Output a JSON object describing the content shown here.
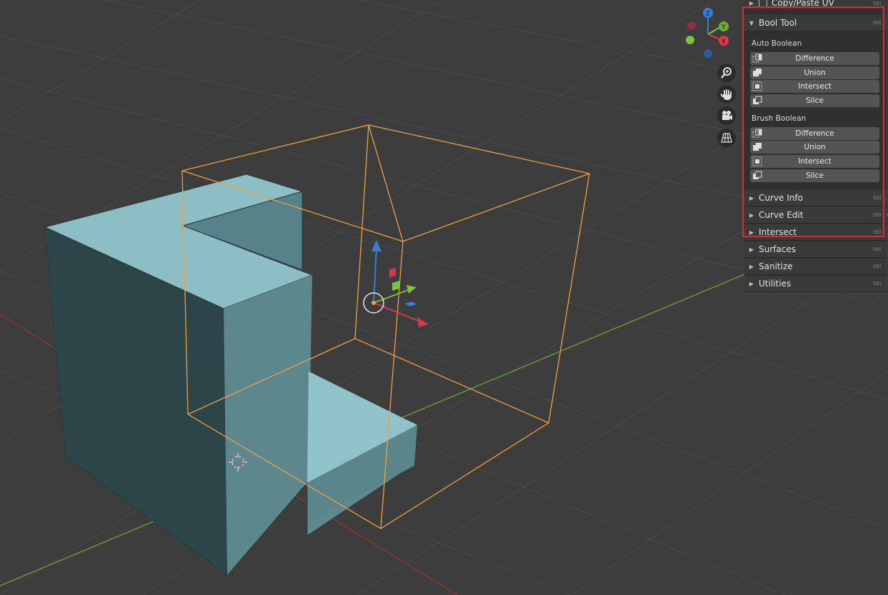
{
  "gizmo": {
    "z": "Z",
    "y": "Y",
    "x": "X"
  },
  "npanel": {
    "top_partial": {
      "title": "Copy/Paste UV"
    },
    "bool_tool": {
      "title": "Bool Tool",
      "auto_label": "Auto Boolean",
      "auto_ops": [
        "Difference",
        "Union",
        "Intersect",
        "Slice"
      ],
      "brush_label": "Brush Boolean",
      "brush_ops": [
        "Difference",
        "Union",
        "Intersect",
        "Slice"
      ]
    },
    "sections": [
      "Curve Info",
      "Curve Edit",
      "Intersect",
      "Surfaces",
      "Sanitize",
      "Utilities"
    ]
  },
  "colors": {
    "viewport_bg": "#3d3d3d",
    "object_face": "#86b8c0",
    "selection_outline": "#f0a040",
    "x_axis": "#9a3a3a",
    "y_axis": "#6f9a2e",
    "highlight_box": "#dd2a35"
  },
  "icons": [
    "zoom-icon",
    "hand-pan-icon",
    "camera-icon",
    "perspective-grid-icon",
    "difference-icon",
    "union-icon",
    "intersect-icon",
    "slice-icon"
  ]
}
